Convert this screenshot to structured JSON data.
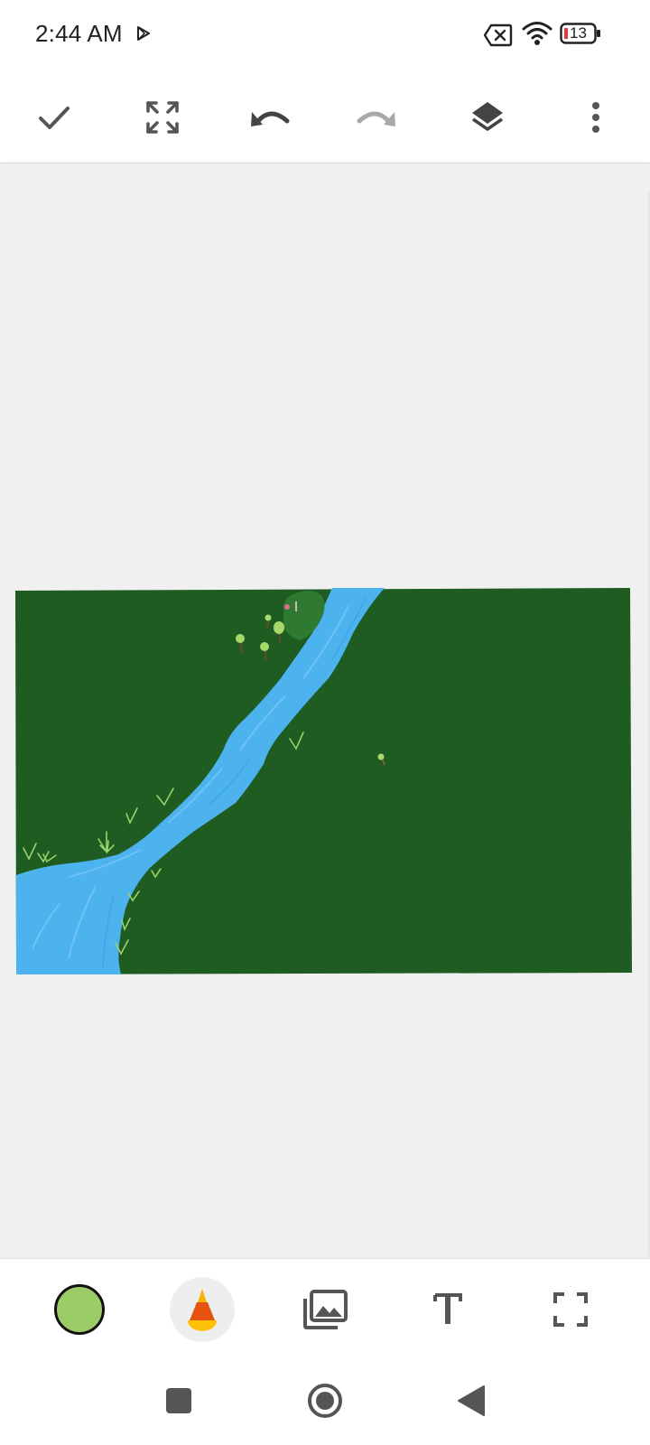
{
  "status_bar": {
    "time": "2:44 AM",
    "battery_level": "13",
    "icons": [
      "play-store-icon",
      "no-sim-icon",
      "wifi-icon",
      "battery-icon"
    ]
  },
  "toolbar": {
    "buttons": [
      "check-icon",
      "fit-screen-icon",
      "undo-icon",
      "redo-icon",
      "layers-icon",
      "more-vert-icon"
    ],
    "redo_enabled": false
  },
  "canvas": {
    "background_color": "#1f5c21",
    "river_color": "#4db3ef",
    "grass_color": "#9ad16a"
  },
  "bottom_toolbar": {
    "current_color": "#9ccc65",
    "tools": [
      "color-swatch",
      "brush-icon",
      "image-gallery-icon",
      "text-icon",
      "crop-frame-icon"
    ]
  },
  "nav_bar": {
    "buttons": [
      "recents-icon",
      "home-icon",
      "back-icon"
    ]
  }
}
